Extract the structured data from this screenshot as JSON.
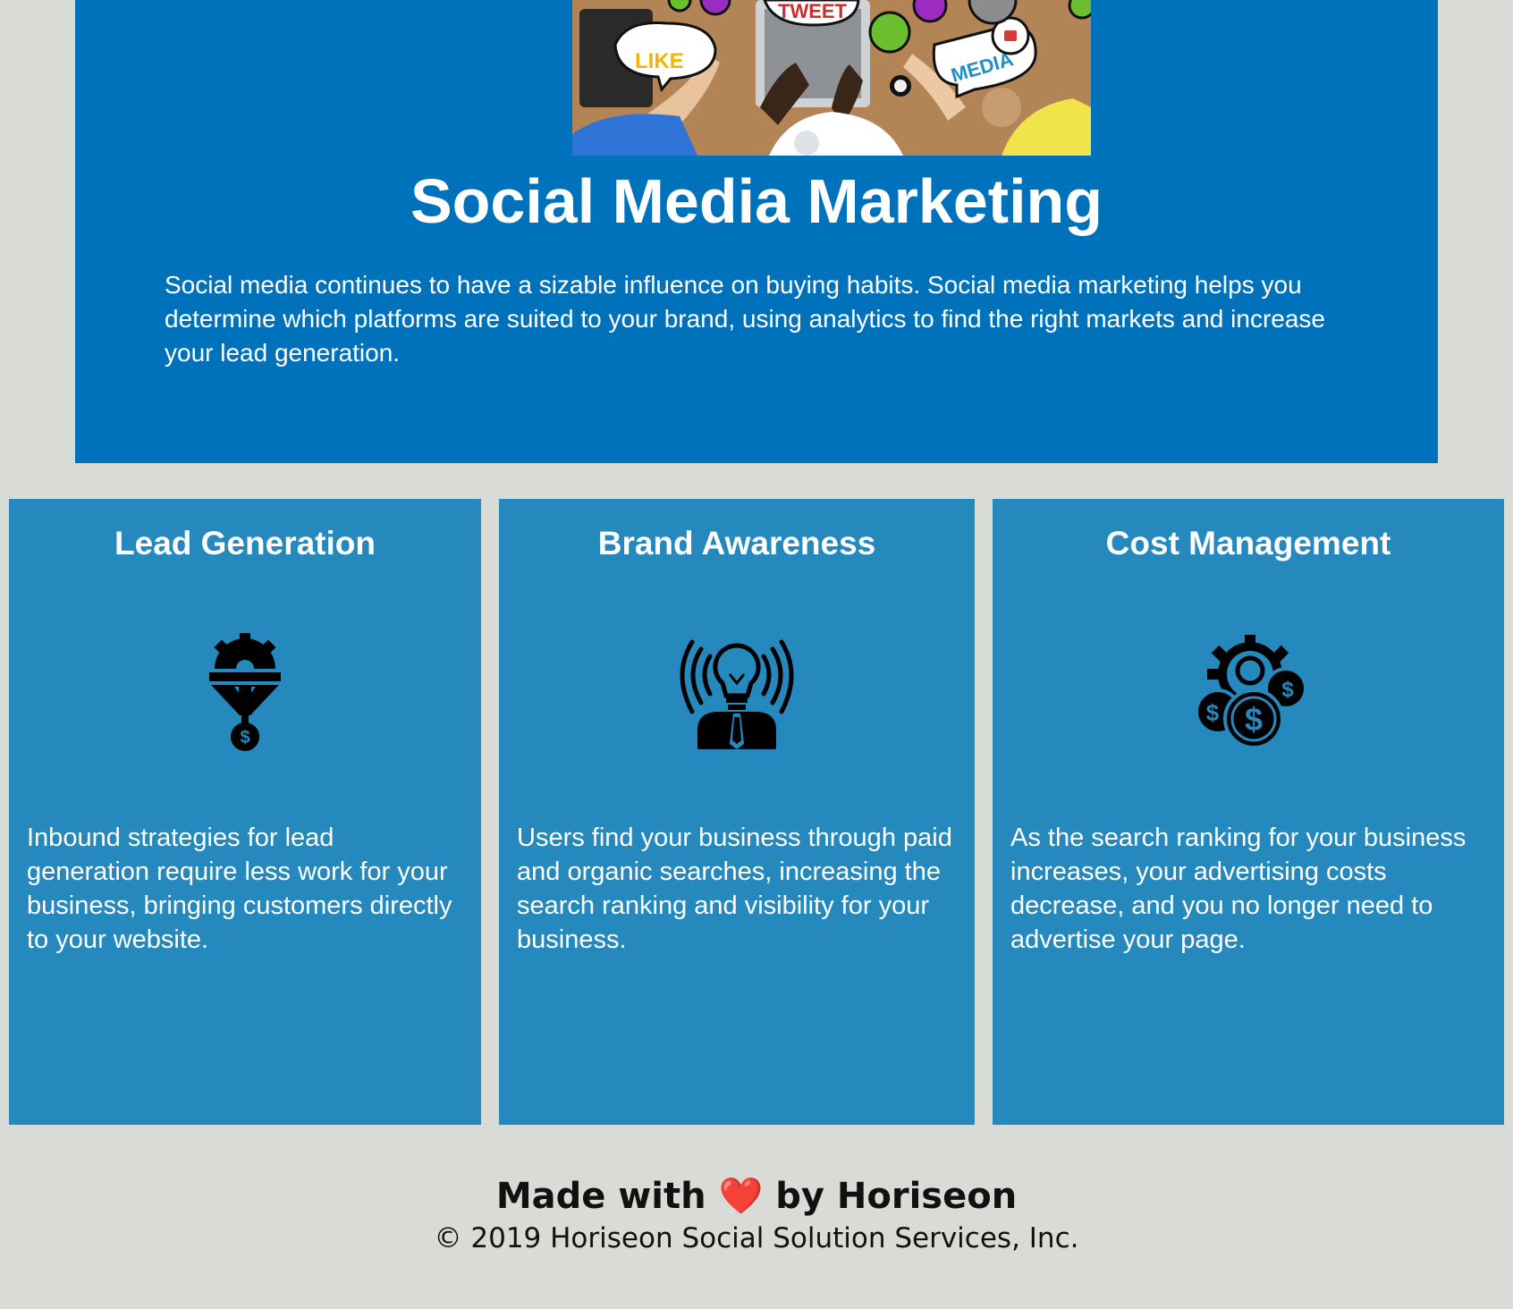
{
  "hero": {
    "title": "Social Media Marketing",
    "text": "Social media continues to have a sizable influence on buying habits. Social media marketing helps you determine which platforms are suited to your brand, using analytics to find the right markets and increase your lead generation.",
    "image_bubbles": [
      "LIKE",
      "TWEET",
      "MEDIA"
    ],
    "background_color": "#0072bb"
  },
  "cards": [
    {
      "title": "Lead Generation",
      "icon": "funnel-gear-dollar-icon",
      "text": "Inbound strategies for lead generation require less work for your business, bringing customers directly to your website."
    },
    {
      "title": "Brand Awareness",
      "icon": "lightbulb-person-broadcast-icon",
      "text": "Users find your business through paid and organic searches, increasing the search ranking and visibility for your business."
    },
    {
      "title": "Cost Management",
      "icon": "gear-coins-dollar-icon",
      "text": "As the search ranking for your business increases, your advertising costs decrease, and you no longer need to advertise your page."
    }
  ],
  "card_color": "#2589bd",
  "footer": {
    "made_with_prefix": "Made with",
    "heart": "❤️",
    "made_with_suffix": "by Horiseon",
    "copyright": "© 2019 Horiseon Social Solution Services, Inc."
  },
  "page_background": "#d9dcd6"
}
